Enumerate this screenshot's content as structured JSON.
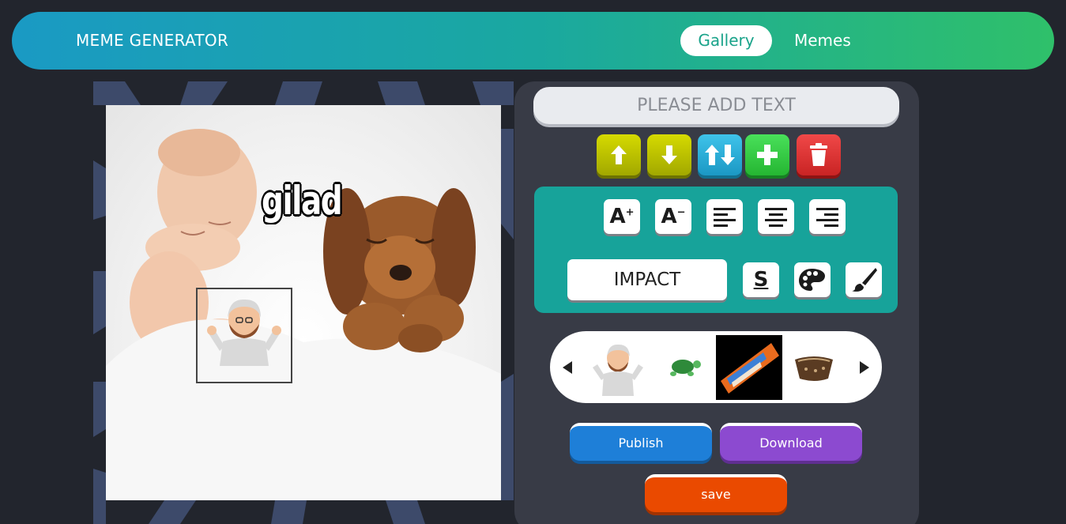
{
  "header": {
    "logo": "MEME GENERATOR",
    "nav": [
      {
        "label": "Gallery",
        "active": true
      },
      {
        "label": "Memes",
        "active": false
      }
    ],
    "gradient": [
      "#1a9ac4",
      "#2fc06a"
    ]
  },
  "canvas": {
    "meme_text": "gilad",
    "image_description_icons": [
      "baby-image",
      "puppy-image",
      "emoji-sticker"
    ]
  },
  "editor": {
    "text_placeholder": "PLEASE ADD TEXT",
    "line_controls": [
      {
        "name": "move-line-up",
        "icon": "arrow-up-icon",
        "color": "#c4c800"
      },
      {
        "name": "move-line-down",
        "icon": "arrow-down-icon",
        "color": "#c4c800"
      },
      {
        "name": "switch-lines",
        "icon": "swap-arrows-icon",
        "color": "#2fb3de"
      },
      {
        "name": "add-line",
        "icon": "plus-icon",
        "color": "#37cc45"
      },
      {
        "name": "delete-line",
        "icon": "trash-icon",
        "color": "#e03a3a"
      }
    ],
    "style": {
      "increase_font": "A",
      "decrease_font": "A",
      "font_family": "IMPACT",
      "stroke_label": "S",
      "panel_color": "#17a39a"
    },
    "stickers": [
      "man-shrug-emoji",
      "turtle-emoji",
      "supreme-sticker",
      "bag-sticker"
    ],
    "actions": {
      "publish": "Publish",
      "download": "Download",
      "save": "save"
    }
  }
}
